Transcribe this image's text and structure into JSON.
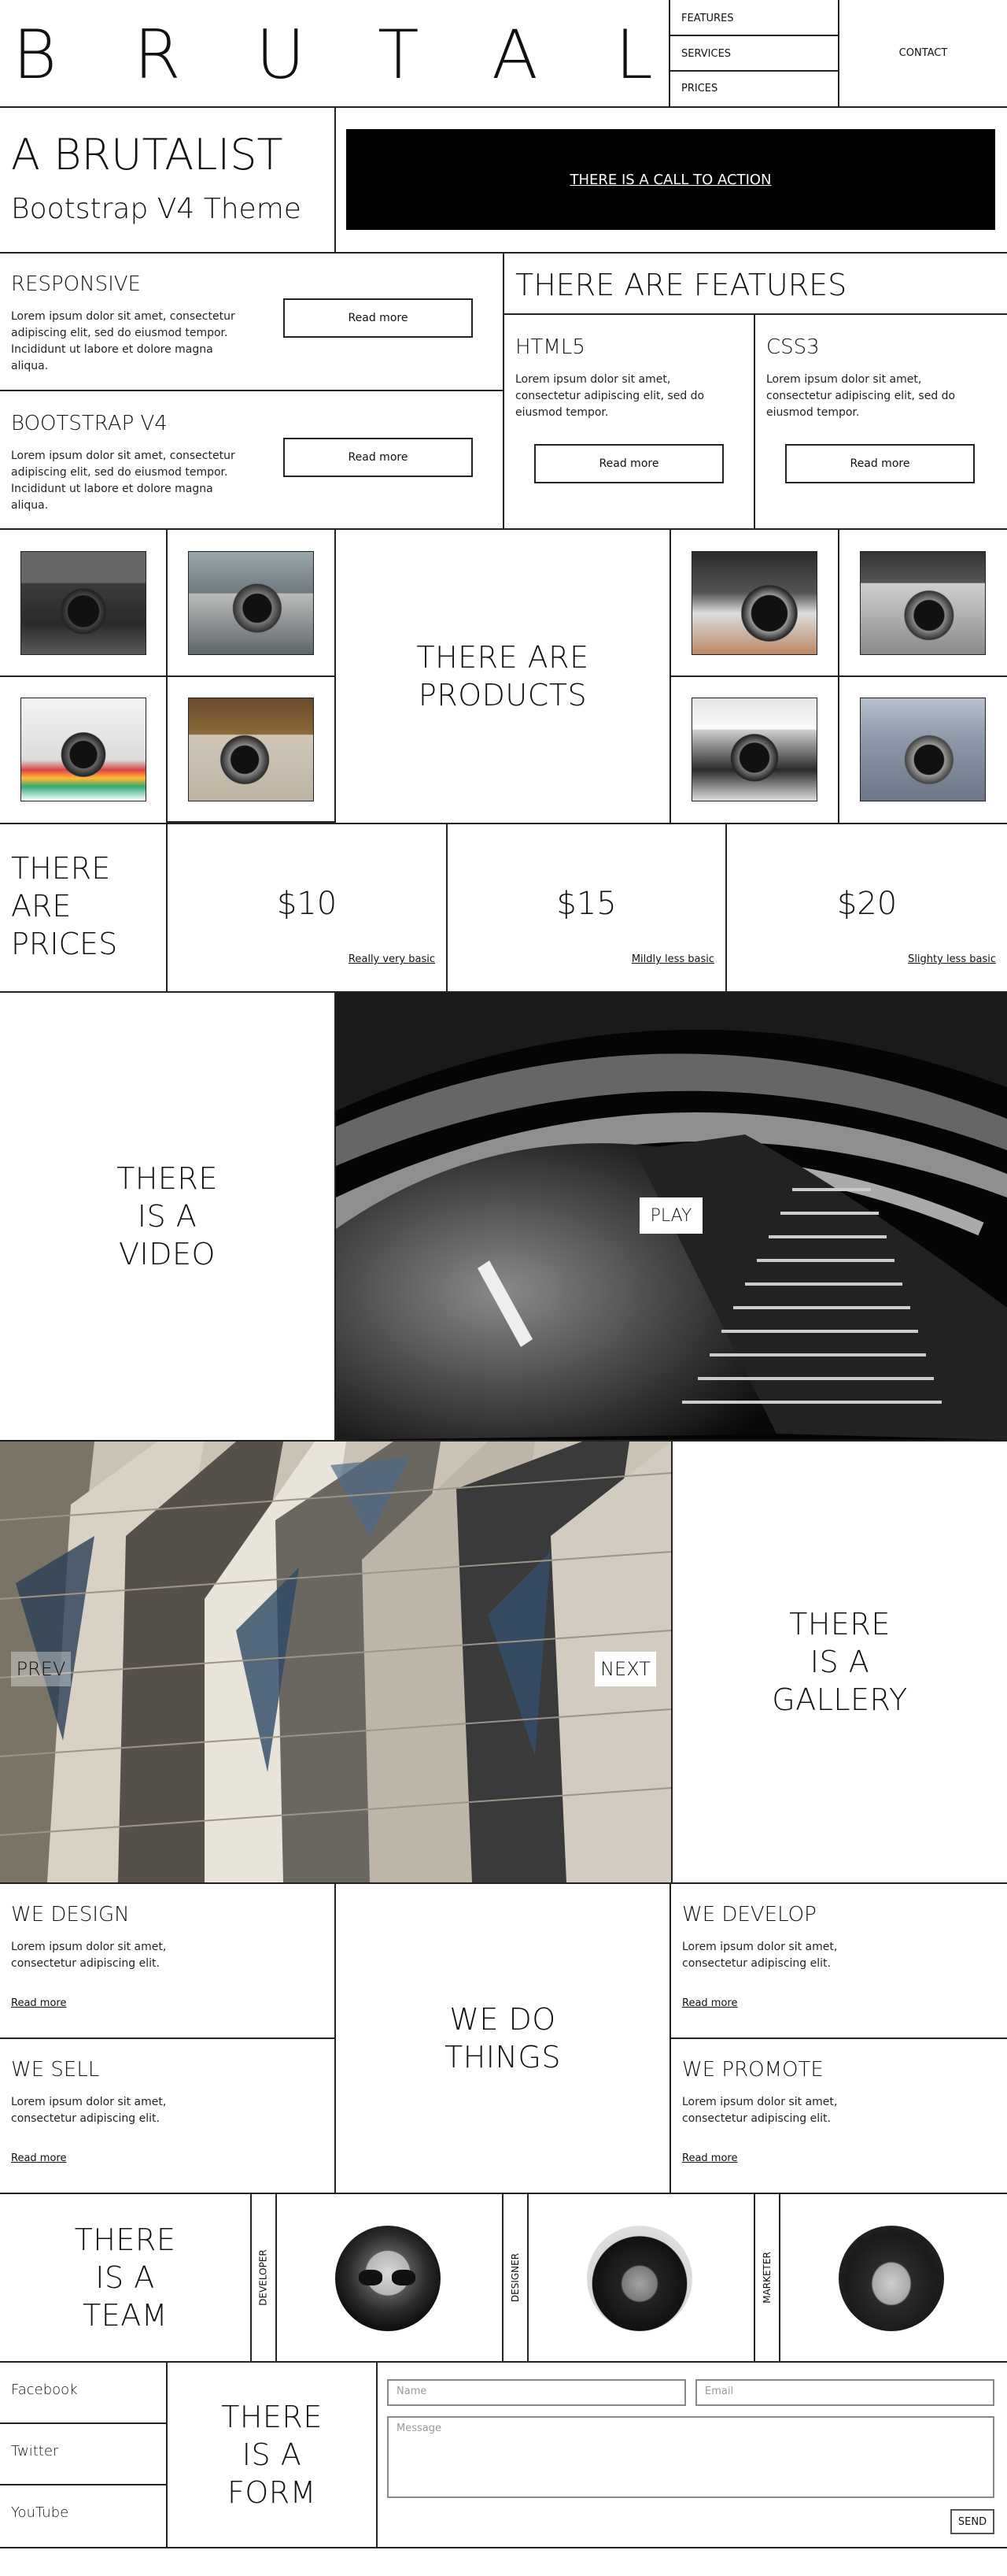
{
  "header": {
    "logo_letters": [
      "B",
      "R",
      "U",
      "T",
      "A",
      "L"
    ],
    "nav": [
      "FEATURES",
      "SERVICES",
      "PRICES"
    ],
    "contact": "CONTACT"
  },
  "hero": {
    "title": "A BRUTALIST",
    "subtitle": "Bootstrap V4 Theme",
    "cta": "THERE IS A CALL TO ACTION"
  },
  "blocks": {
    "responsive": {
      "title": "RESPONSIVE",
      "text": "Lorem ipsum dolor sit amet, consectetur adipiscing elit, sed do eiusmod tempor. Incididunt ut labore et dolore magna aliqua.",
      "button": "Read more"
    },
    "bootstrap": {
      "title": "BOOTSTRAP V4",
      "text": "Lorem ipsum dolor sit amet, consectetur adipiscing elit, sed do eiusmod tempor. Incididunt ut labore et dolore magna aliqua.",
      "button": "Read more"
    }
  },
  "features": {
    "heading": "THERE ARE FEATURES",
    "items": [
      {
        "title": "HTML5",
        "text": "Lorem ipsum dolor sit amet, consectetur adipiscing elit, sed do eiusmod tempor.",
        "button": "Read more"
      },
      {
        "title": "CSS3",
        "text": "Lorem ipsum dolor sit amet, consectetur adipiscing elit, sed do eiusmod tempor.",
        "button": "Read more"
      }
    ]
  },
  "products": {
    "heading_line1": "THERE ARE",
    "heading_line2": "PRODUCTS"
  },
  "prices": {
    "heading": [
      "THERE",
      "ARE",
      "PRICES"
    ],
    "plans": [
      {
        "price": "$10",
        "label": "Really very basic"
      },
      {
        "price": "$15",
        "label": "Mildly less basic"
      },
      {
        "price": "$20",
        "label": "Slighty less basic"
      }
    ]
  },
  "video": {
    "heading": [
      "THERE",
      "IS A",
      "VIDEO"
    ],
    "play": "PLAY"
  },
  "gallery": {
    "prev": "PREV",
    "next": "NEXT",
    "heading": [
      "THERE",
      "IS A",
      "GALLERY"
    ]
  },
  "services": {
    "heading": [
      "WE DO",
      "THINGS"
    ],
    "items": [
      {
        "title": "WE DESIGN",
        "text": "Lorem ipsum dolor sit amet, consectetur adipiscing elit.",
        "link": "Read more"
      },
      {
        "title": "WE DEVELOP",
        "text": "Lorem ipsum dolor sit amet, consectetur adipiscing elit.",
        "link": "Read more"
      },
      {
        "title": "WE SELL",
        "text": "Lorem ipsum dolor sit amet, consectetur adipiscing elit.",
        "link": "Read more"
      },
      {
        "title": "WE PROMOTE",
        "text": "Lorem ipsum dolor sit amet, consectetur adipiscing elit.",
        "link": "Read more"
      }
    ]
  },
  "team": {
    "heading": [
      "THERE",
      "IS A",
      "TEAM"
    ],
    "members": [
      {
        "role": "DEVELOPER"
      },
      {
        "role": "DESIGNER"
      },
      {
        "role": "MARKETER"
      }
    ]
  },
  "social": [
    "Facebook",
    "Twitter",
    "YouTube"
  ],
  "form": {
    "heading": [
      "THERE",
      "IS A",
      "FORM"
    ],
    "name_placeholder": "Name",
    "email_placeholder": "Email",
    "message_placeholder": "Message",
    "send": "SEND"
  }
}
